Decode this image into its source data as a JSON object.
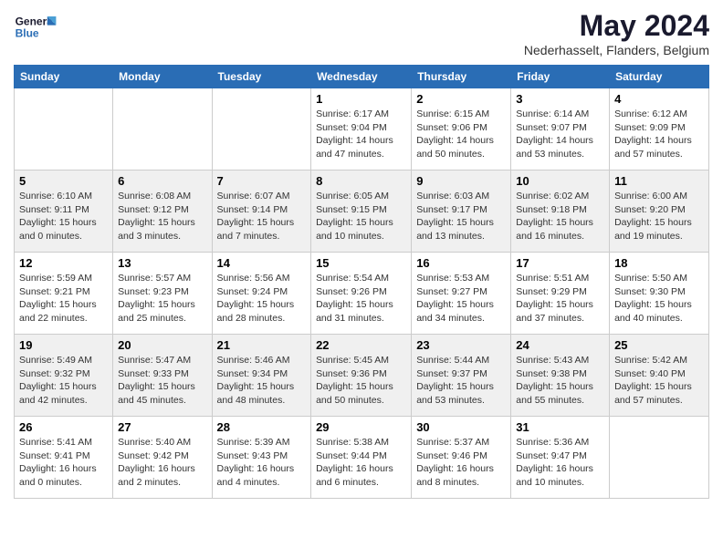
{
  "header": {
    "logo_general": "General",
    "logo_blue": "Blue",
    "title": "May 2024",
    "location": "Nederhasselt, Flanders, Belgium"
  },
  "weekdays": [
    "Sunday",
    "Monday",
    "Tuesday",
    "Wednesday",
    "Thursday",
    "Friday",
    "Saturday"
  ],
  "weeks": [
    [
      {
        "day": "",
        "empty": true
      },
      {
        "day": "",
        "empty": true
      },
      {
        "day": "",
        "empty": true
      },
      {
        "day": "1",
        "sunrise": "6:17 AM",
        "sunset": "9:04 PM",
        "daylight": "14 hours and 47 minutes."
      },
      {
        "day": "2",
        "sunrise": "6:15 AM",
        "sunset": "9:06 PM",
        "daylight": "14 hours and 50 minutes."
      },
      {
        "day": "3",
        "sunrise": "6:14 AM",
        "sunset": "9:07 PM",
        "daylight": "14 hours and 53 minutes."
      },
      {
        "day": "4",
        "sunrise": "6:12 AM",
        "sunset": "9:09 PM",
        "daylight": "14 hours and 57 minutes."
      }
    ],
    [
      {
        "day": "5",
        "sunrise": "6:10 AM",
        "sunset": "9:11 PM",
        "daylight": "15 hours and 0 minutes."
      },
      {
        "day": "6",
        "sunrise": "6:08 AM",
        "sunset": "9:12 PM",
        "daylight": "15 hours and 3 minutes."
      },
      {
        "day": "7",
        "sunrise": "6:07 AM",
        "sunset": "9:14 PM",
        "daylight": "15 hours and 7 minutes."
      },
      {
        "day": "8",
        "sunrise": "6:05 AM",
        "sunset": "9:15 PM",
        "daylight": "15 hours and 10 minutes."
      },
      {
        "day": "9",
        "sunrise": "6:03 AM",
        "sunset": "9:17 PM",
        "daylight": "15 hours and 13 minutes."
      },
      {
        "day": "10",
        "sunrise": "6:02 AM",
        "sunset": "9:18 PM",
        "daylight": "15 hours and 16 minutes."
      },
      {
        "day": "11",
        "sunrise": "6:00 AM",
        "sunset": "9:20 PM",
        "daylight": "15 hours and 19 minutes."
      }
    ],
    [
      {
        "day": "12",
        "sunrise": "5:59 AM",
        "sunset": "9:21 PM",
        "daylight": "15 hours and 22 minutes."
      },
      {
        "day": "13",
        "sunrise": "5:57 AM",
        "sunset": "9:23 PM",
        "daylight": "15 hours and 25 minutes."
      },
      {
        "day": "14",
        "sunrise": "5:56 AM",
        "sunset": "9:24 PM",
        "daylight": "15 hours and 28 minutes."
      },
      {
        "day": "15",
        "sunrise": "5:54 AM",
        "sunset": "9:26 PM",
        "daylight": "15 hours and 31 minutes."
      },
      {
        "day": "16",
        "sunrise": "5:53 AM",
        "sunset": "9:27 PM",
        "daylight": "15 hours and 34 minutes."
      },
      {
        "day": "17",
        "sunrise": "5:51 AM",
        "sunset": "9:29 PM",
        "daylight": "15 hours and 37 minutes."
      },
      {
        "day": "18",
        "sunrise": "5:50 AM",
        "sunset": "9:30 PM",
        "daylight": "15 hours and 40 minutes."
      }
    ],
    [
      {
        "day": "19",
        "sunrise": "5:49 AM",
        "sunset": "9:32 PM",
        "daylight": "15 hours and 42 minutes."
      },
      {
        "day": "20",
        "sunrise": "5:47 AM",
        "sunset": "9:33 PM",
        "daylight": "15 hours and 45 minutes."
      },
      {
        "day": "21",
        "sunrise": "5:46 AM",
        "sunset": "9:34 PM",
        "daylight": "15 hours and 48 minutes."
      },
      {
        "day": "22",
        "sunrise": "5:45 AM",
        "sunset": "9:36 PM",
        "daylight": "15 hours and 50 minutes."
      },
      {
        "day": "23",
        "sunrise": "5:44 AM",
        "sunset": "9:37 PM",
        "daylight": "15 hours and 53 minutes."
      },
      {
        "day": "24",
        "sunrise": "5:43 AM",
        "sunset": "9:38 PM",
        "daylight": "15 hours and 55 minutes."
      },
      {
        "day": "25",
        "sunrise": "5:42 AM",
        "sunset": "9:40 PM",
        "daylight": "15 hours and 57 minutes."
      }
    ],
    [
      {
        "day": "26",
        "sunrise": "5:41 AM",
        "sunset": "9:41 PM",
        "daylight": "16 hours and 0 minutes."
      },
      {
        "day": "27",
        "sunrise": "5:40 AM",
        "sunset": "9:42 PM",
        "daylight": "16 hours and 2 minutes."
      },
      {
        "day": "28",
        "sunrise": "5:39 AM",
        "sunset": "9:43 PM",
        "daylight": "16 hours and 4 minutes."
      },
      {
        "day": "29",
        "sunrise": "5:38 AM",
        "sunset": "9:44 PM",
        "daylight": "16 hours and 6 minutes."
      },
      {
        "day": "30",
        "sunrise": "5:37 AM",
        "sunset": "9:46 PM",
        "daylight": "16 hours and 8 minutes."
      },
      {
        "day": "31",
        "sunrise": "5:36 AM",
        "sunset": "9:47 PM",
        "daylight": "16 hours and 10 minutes."
      },
      {
        "day": "",
        "empty": true
      }
    ]
  ],
  "labels": {
    "sunrise": "Sunrise:",
    "sunset": "Sunset:",
    "daylight": "Daylight:"
  }
}
